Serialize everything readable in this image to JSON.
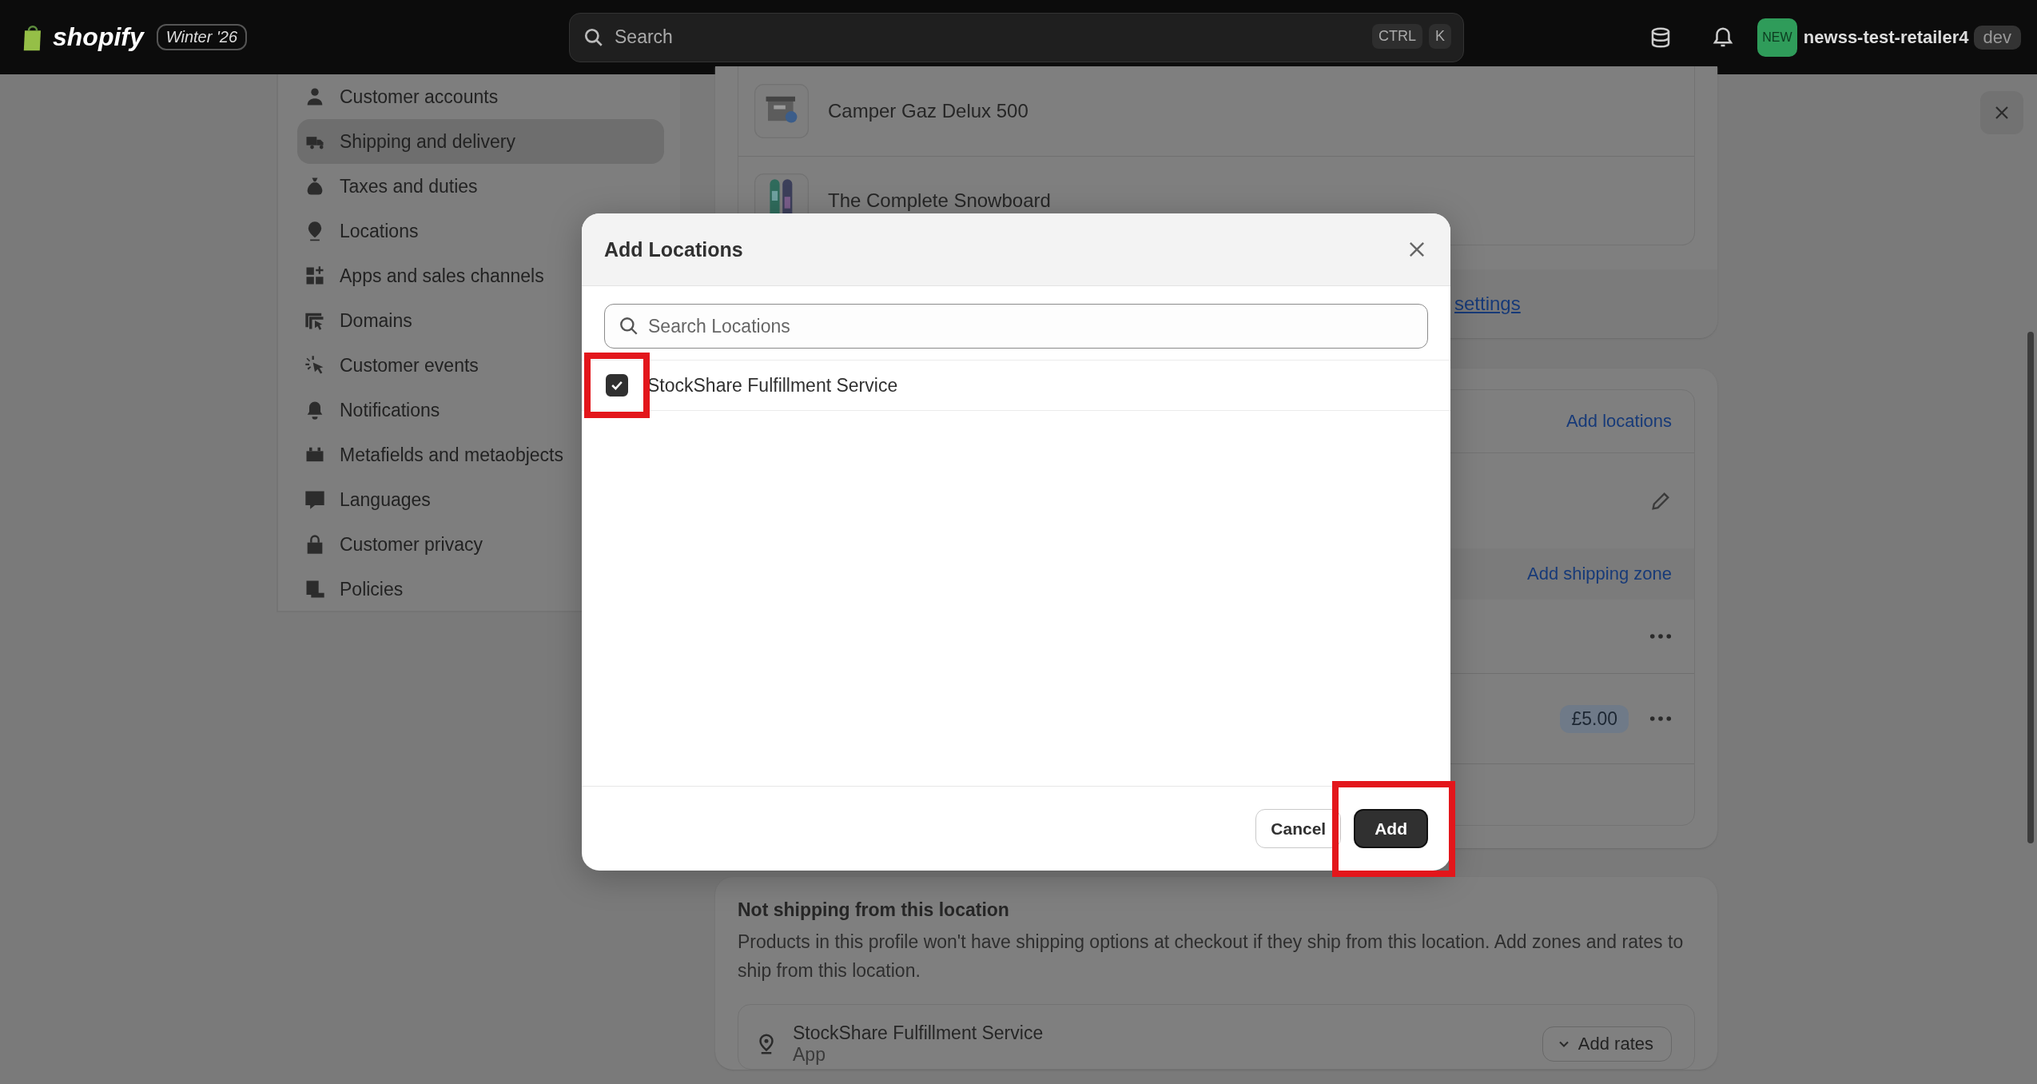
{
  "top_bar": {
    "logo": "shopify",
    "edition": "Winter '26",
    "search": {
      "placeholder": "Search",
      "shortcut": [
        "CTRL",
        "K"
      ]
    },
    "store": {
      "avatar": "NEW",
      "name": "newss-test-retailer4",
      "badge": "dev"
    }
  },
  "sidebar": {
    "items": [
      {
        "label": "Customer accounts",
        "selected": false
      },
      {
        "label": "Shipping and delivery",
        "selected": true
      },
      {
        "label": "Taxes and duties",
        "selected": false
      },
      {
        "label": "Locations",
        "selected": false
      },
      {
        "label": "Apps and sales channels",
        "selected": false
      },
      {
        "label": "Domains",
        "selected": false
      },
      {
        "label": "Customer events",
        "selected": false
      },
      {
        "label": "Notifications",
        "selected": false
      },
      {
        "label": "Metafields and metaobjects",
        "selected": false
      },
      {
        "label": "Languages",
        "selected": false
      },
      {
        "label": "Customer privacy",
        "selected": false
      },
      {
        "label": "Policies",
        "selected": false
      }
    ]
  },
  "main": {
    "products": [
      {
        "name": "Camper Gaz Delux 500"
      },
      {
        "name": "The Complete Snowboard"
      }
    ],
    "settings_link": "settings",
    "locations_card": {
      "add_locations": "Add locations",
      "add_shipping_zone": "Add shipping zone",
      "rate_price": "£5.00"
    },
    "not_shipping": {
      "title": "Not shipping from this location",
      "description": "Products in this profile won't have shipping options at checkout if they ship from this location. Add zones and rates to ship from this location.",
      "location": {
        "name": "StockShare Fulfillment Service",
        "type": "App"
      },
      "add_rates": "Add rates"
    }
  },
  "modal": {
    "title": "Add Locations",
    "search": {
      "placeholder": "Search Locations"
    },
    "locations": [
      {
        "name": "StockShare Fulfillment Service",
        "checked": true,
        "highlight": true
      }
    ],
    "buttons": [
      {
        "label": "Cancel",
        "kind": "secondary",
        "highlight": false
      },
      {
        "label": "Add",
        "kind": "primary",
        "highlight": true
      }
    ]
  }
}
